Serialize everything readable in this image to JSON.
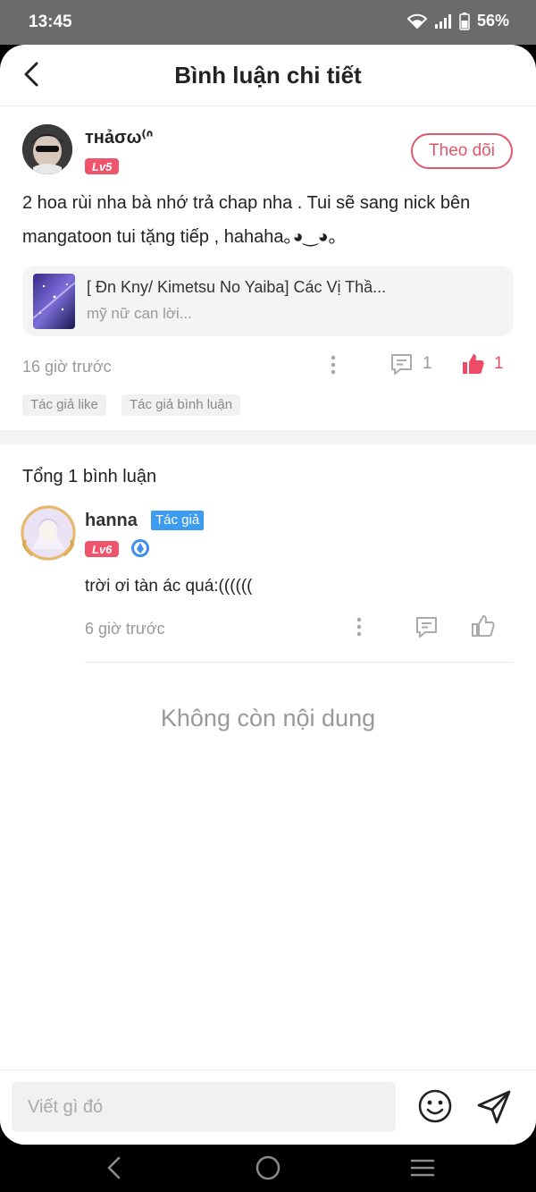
{
  "status_bar": {
    "time": "13:45",
    "battery": "56%"
  },
  "header": {
    "title": "Bình luận chi tiết"
  },
  "post": {
    "username": "ᴛʜảσω⁽ᐢ",
    "level": "Lv5",
    "follow_label": "Theo dõi",
    "text": "2 hoa rùi nha bà nhớ trả chap nha . Tui sẽ sang nick bên mangatoon tui tặng tiếp , hahaha｡◕‿◕｡",
    "work_title": "[ Đn Kny/ Kimetsu No Yaiba] Các Vị Thầ...",
    "work_subtitle": "mỹ nữ can lời...",
    "time": "16 giờ trước",
    "reply_count": "1",
    "like_count": "1",
    "tags": [
      "Tác giả like",
      "Tác giả bình luận"
    ]
  },
  "comments_section": {
    "total_label": "Tổng 1 bình luận"
  },
  "comments": [
    {
      "username": "hanna",
      "author_badge": "Tác giả",
      "level": "Lv6",
      "text": "trời ơi tàn ác quá:((((((",
      "time": "6 giờ trước"
    }
  ],
  "empty_message": "Không còn nội dung",
  "input": {
    "placeholder": "Viết gì đó"
  },
  "colors": {
    "accent": "#ee4b66",
    "author_badge": "#3d9cf0",
    "text_muted": "#999999"
  }
}
